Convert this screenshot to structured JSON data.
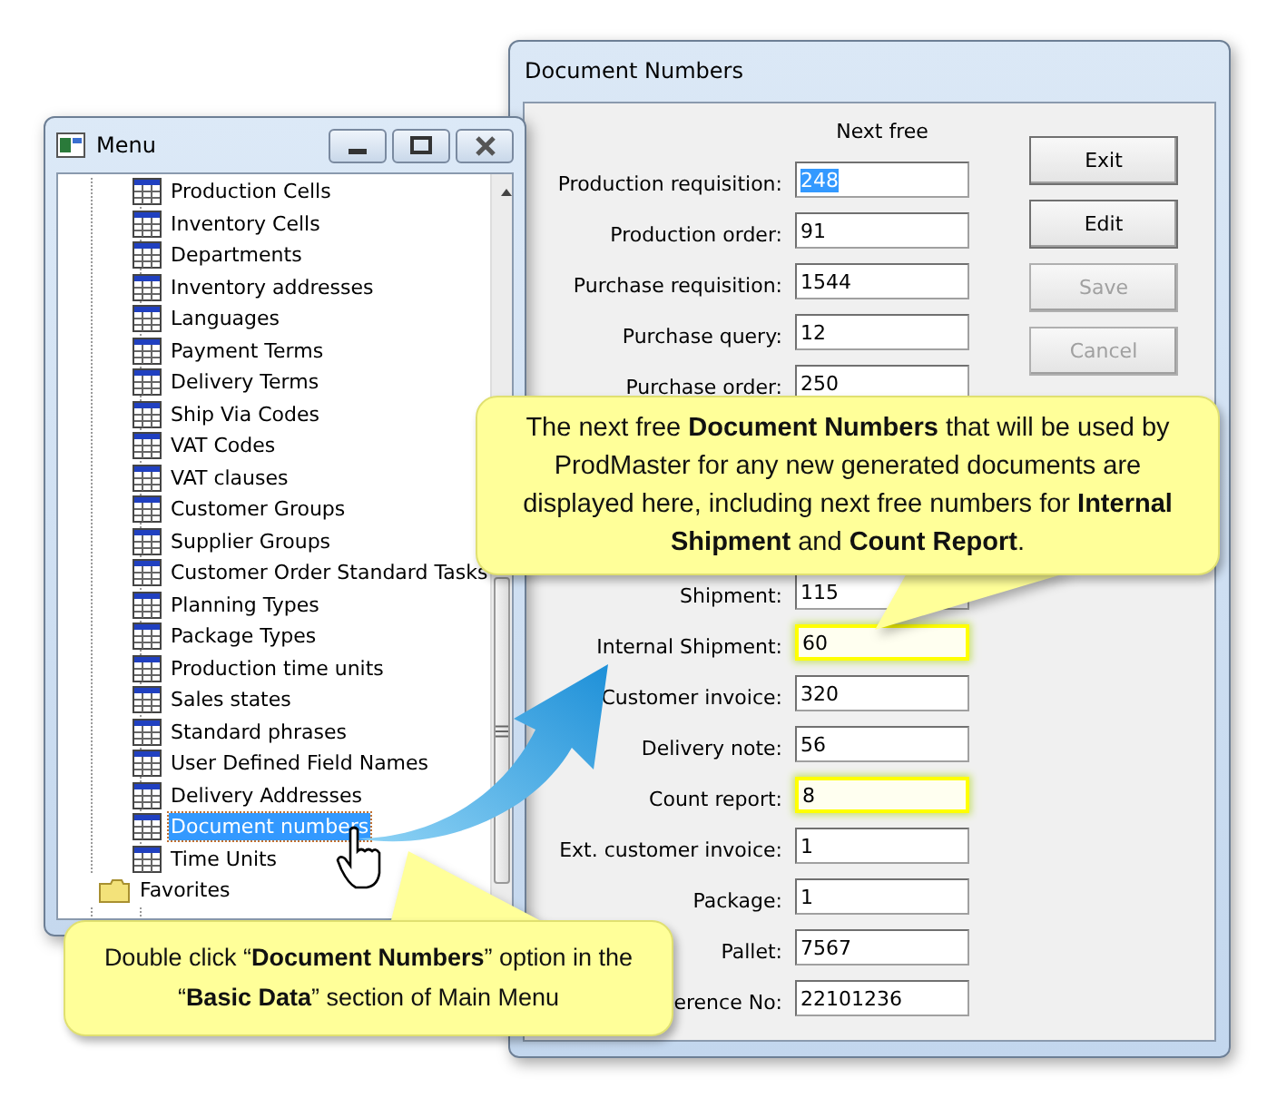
{
  "menu_window": {
    "title": "Menu",
    "items": [
      {
        "label": "Production Cells",
        "selected": false
      },
      {
        "label": "Inventory Cells",
        "selected": false
      },
      {
        "label": "Departments",
        "selected": false
      },
      {
        "label": "Inventory addresses",
        "selected": false
      },
      {
        "label": "Languages",
        "selected": false
      },
      {
        "label": "Payment Terms",
        "selected": false
      },
      {
        "label": "Delivery Terms",
        "selected": false
      },
      {
        "label": "Ship Via Codes",
        "selected": false
      },
      {
        "label": "VAT Codes",
        "selected": false
      },
      {
        "label": "VAT clauses",
        "selected": false
      },
      {
        "label": "Customer Groups",
        "selected": false
      },
      {
        "label": "Supplier Groups",
        "selected": false
      },
      {
        "label": "Customer Order Standard Tasks",
        "selected": false
      },
      {
        "label": "Planning Types",
        "selected": false
      },
      {
        "label": "Package Types",
        "selected": false
      },
      {
        "label": "Production time units",
        "selected": false
      },
      {
        "label": "Sales states",
        "selected": false
      },
      {
        "label": "Standard phrases",
        "selected": false
      },
      {
        "label": "User Defined Field Names",
        "selected": false
      },
      {
        "label": "Delivery Addresses",
        "selected": false
      },
      {
        "label": "Document numbers",
        "selected": true
      },
      {
        "label": "Time Units",
        "selected": false
      }
    ],
    "folder": {
      "label": "Favorites"
    }
  },
  "dialog": {
    "title": "Document Numbers",
    "column_header": "Next free",
    "fields": [
      {
        "label": "Production requisition:",
        "value": "248",
        "selected": true,
        "highlighted": false
      },
      {
        "label": "Production order:",
        "value": "91",
        "selected": false,
        "highlighted": false
      },
      {
        "label": "Purchase requisition:",
        "value": "1544",
        "selected": false,
        "highlighted": false
      },
      {
        "label": "Purchase query:",
        "value": "12",
        "selected": false,
        "highlighted": false
      },
      {
        "label": "Purchase order:",
        "value": "250",
        "selected": false,
        "highlighted": false
      },
      {
        "label": "Shipment:",
        "value": "115",
        "selected": false,
        "highlighted": false
      },
      {
        "label": "Internal Shipment:",
        "value": "60",
        "selected": false,
        "highlighted": true
      },
      {
        "label": "Customer invoice:",
        "value": "320",
        "selected": false,
        "highlighted": false
      },
      {
        "label": "Delivery note:",
        "value": "56",
        "selected": false,
        "highlighted": false
      },
      {
        "label": "Count report:",
        "value": "8",
        "selected": false,
        "highlighted": true
      },
      {
        "label": "Ext. customer invoice:",
        "value": "1",
        "selected": false,
        "highlighted": false
      },
      {
        "label": "Package:",
        "value": "1",
        "selected": false,
        "highlighted": false
      },
      {
        "label": "Pallet:",
        "value": "7567",
        "selected": false,
        "highlighted": false
      },
      {
        "label": "erence No:",
        "value": "22101236",
        "selected": false,
        "highlighted": false
      }
    ],
    "buttons": [
      {
        "label": "Exit",
        "disabled": false
      },
      {
        "label": "Edit",
        "disabled": false
      },
      {
        "label": "Save",
        "disabled": true
      },
      {
        "label": "Cancel",
        "disabled": true
      }
    ]
  },
  "callouts": [
    {
      "text": "The next free **Document Numbers** that will be used by ProdMaster for any new generated documents are displayed here, including next free numbers for **Internal Shipment** and **Count Report**."
    },
    {
      "text": "Double click “**Document Numbers**” option in the “**Basic Data**” section of Main Menu"
    }
  ]
}
